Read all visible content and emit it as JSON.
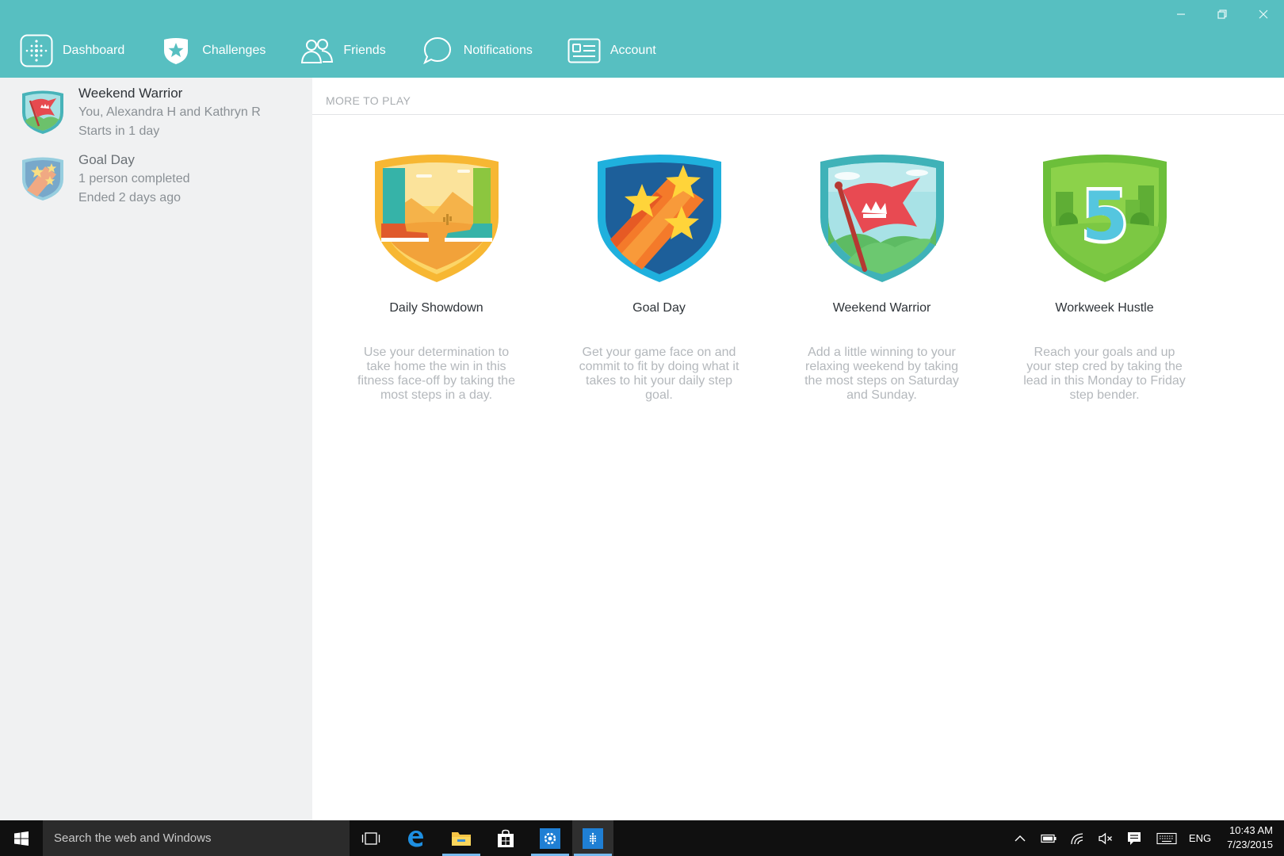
{
  "window": {
    "controls": [
      "minimize-icon",
      "restore-icon",
      "close-icon"
    ]
  },
  "nav": {
    "items": [
      {
        "label": "Dashboard",
        "icon": "dashboard-icon"
      },
      {
        "label": "Challenges",
        "icon": "challenges-star-badge-icon"
      },
      {
        "label": "Friends",
        "icon": "friends-icon"
      },
      {
        "label": "Notifications",
        "icon": "notifications-bubble-icon"
      },
      {
        "label": "Account",
        "icon": "account-card-icon"
      }
    ]
  },
  "sidebar": {
    "challenges": [
      {
        "title": "Weekend Warrior",
        "line1": "You, Alexandra H and Kathryn R",
        "line2": "Starts in 1 day",
        "badge": "weekend-warrior-badge-icon"
      },
      {
        "title": "Goal Day",
        "line1": "1 person completed",
        "line2": "Ended 2 days ago",
        "badge": "goal-day-badge-icon"
      }
    ]
  },
  "main": {
    "section_title": "MORE TO PLAY",
    "cards": [
      {
        "title": "Daily Showdown",
        "description": "Use your determination to take home the win in this fitness face-off by taking the most steps in a day.",
        "badge": "daily-showdown-badge-icon"
      },
      {
        "title": "Goal Day",
        "description": "Get your game face on and commit to fit by doing what it takes to hit your daily step goal.",
        "badge": "goal-day-badge-icon"
      },
      {
        "title": "Weekend Warrior",
        "description": "Add a little winning to your relaxing weekend by taking the most steps on Saturday and Sunday.",
        "badge": "weekend-warrior-badge-icon"
      },
      {
        "title": "Workweek Hustle",
        "description": "Reach your goals and up your step cred by taking the lead in this Monday to Friday step bender.",
        "badge": "workweek-hustle-badge-icon"
      }
    ]
  },
  "taskbar": {
    "search_placeholder": "Search the web and Windows",
    "language": "ENG",
    "time": "10:43 AM",
    "date": "7/23/2015"
  },
  "colors": {
    "header": "#57bfc1",
    "sidebar": "#f0f1f2",
    "taskbar": "#101010"
  }
}
